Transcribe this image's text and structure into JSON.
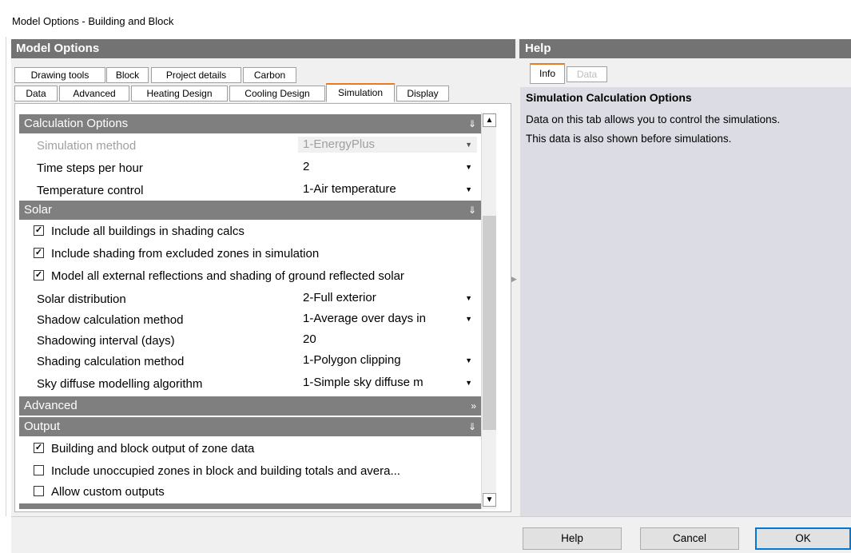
{
  "window": {
    "title": "Model Options - Building and Block"
  },
  "left_panel": {
    "title": "Model Options",
    "tabs_row1": [
      "Drawing tools",
      "Block",
      "Project details",
      "Carbon"
    ],
    "tabs_row2": [
      "Data",
      "Advanced",
      "Heating Design",
      "Cooling Design",
      "Simulation",
      "Display"
    ],
    "active_tab": "Simulation"
  },
  "grid": {
    "calc": {
      "title": "Calculation Options",
      "simulation_method": {
        "label": "Simulation method",
        "value": "1-EnergyPlus",
        "disabled": true
      },
      "time_steps": {
        "label": "Time steps per hour",
        "value": "2"
      },
      "temp_control": {
        "label": "Temperature control",
        "value": "1-Air temperature"
      }
    },
    "solar": {
      "title": "Solar",
      "chk1": {
        "label": "Include all buildings in shading calcs",
        "checked": true
      },
      "chk2": {
        "label": "Include shading from excluded zones in simulation",
        "checked": true
      },
      "chk3": {
        "label": "Model all external reflections and shading of ground reflected solar",
        "checked": true
      },
      "solar_distribution": {
        "label": "Solar distribution",
        "value": "2-Full exterior"
      },
      "shadow_method": {
        "label": "Shadow calculation method",
        "value": "1-Average over days in"
      },
      "shadow_interval": {
        "label": "Shadowing interval (days)",
        "value": "20"
      },
      "shading_method": {
        "label": "Shading calculation method",
        "value": "1-Polygon clipping"
      },
      "sky_diffuse": {
        "label": "Sky diffuse modelling algorithm",
        "value": "1-Simple sky diffuse m"
      }
    },
    "advanced": {
      "title": "Advanced"
    },
    "output": {
      "title": "Output",
      "chk1": {
        "label": "Building and block output of zone data",
        "checked": true
      },
      "chk2": {
        "label": "Include unoccupied zones in block and building totals and avera...",
        "checked": false
      },
      "chk3": {
        "label": "Allow custom outputs",
        "checked": false
      }
    }
  },
  "help_panel": {
    "title": "Help",
    "tabs": [
      "Info",
      "Data"
    ],
    "active_tab": "Info",
    "heading": "Simulation Calculation Options",
    "line1": "Data on this tab allows you to control the simulations.",
    "line2": "This data is also shown before simulations."
  },
  "buttons": {
    "help": "Help",
    "cancel": "Cancel",
    "ok": "OK"
  },
  "icons": {
    "collapse": "double-chevron-up-icon",
    "expand": "double-chevron-right-icon",
    "dropdown": "dropdown-arrow-icon",
    "checkbox_checked": "check-icon"
  },
  "colors": {
    "header": "#737373",
    "category": "#7f7f7f",
    "active_tab_accent": "#e87a1f",
    "help_bg": "#dcdde4",
    "default_button": "#0078d7"
  }
}
